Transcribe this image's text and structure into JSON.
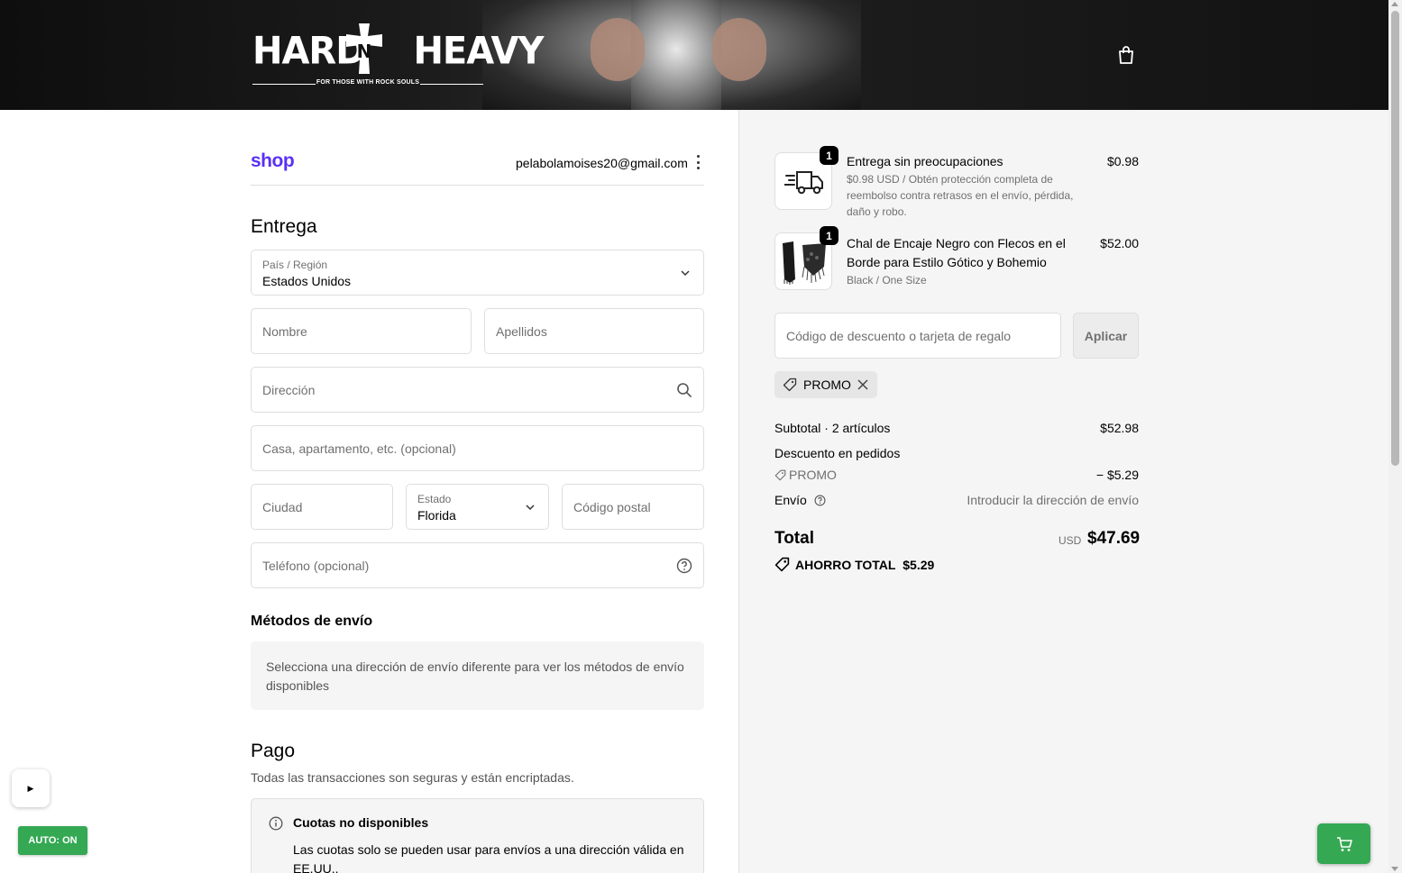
{
  "header": {
    "logo_left": "HARD",
    "logo_right": "HEAVY",
    "logo_tagline": "FOR THOSE WITH ROCK SOULS",
    "cart_icon": "shopping-bag-icon"
  },
  "account": {
    "shop_logo": "shop",
    "email": "pelabolamoises20@gmail.com",
    "menu_icon": "kebab-menu-icon"
  },
  "delivery": {
    "title": "Entrega",
    "country": {
      "label": "País / Región",
      "value": "Estados Unidos"
    },
    "first_name": {
      "placeholder": "Nombre"
    },
    "last_name": {
      "placeholder": "Apellidos"
    },
    "address": {
      "placeholder": "Dirección"
    },
    "apartment": {
      "placeholder": "Casa, apartamento, etc. (opcional)"
    },
    "city": {
      "placeholder": "Ciudad"
    },
    "state": {
      "label": "Estado",
      "value": "Florida"
    },
    "postal": {
      "placeholder": "Código postal"
    },
    "phone": {
      "placeholder": "Teléfono (opcional)"
    }
  },
  "shipping_methods": {
    "title": "Métodos de envío",
    "message": "Selecciona una dirección de envío diferente para ver los métodos de envío disponibles"
  },
  "payment": {
    "title": "Pago",
    "subtitle": "Todas las transacciones son seguras y están encriptadas.",
    "notice_title": "Cuotas no disponibles",
    "notice_text": "Las cuotas solo se pueden usar para envíos a una dirección válida en EE.UU.."
  },
  "summary": {
    "items": [
      {
        "qty": "1",
        "title": "Entrega sin preocupaciones",
        "subtitle": "$0.98 USD / Obtén protección completa de reembolso contra retrasos en el envío, pérdida, daño y robo.",
        "price": "$0.98",
        "thumb_icon": "delivery-truck-icon"
      },
      {
        "qty": "1",
        "title": "Chal de Encaje Negro con Flecos en el Borde para Estilo Gótico y Bohemio",
        "subtitle": "Black / One Size",
        "price": "$52.00",
        "thumb_icon": "black-shawl-image"
      }
    ],
    "discount_placeholder": "Código de descuento o tarjeta de regalo",
    "apply_label": "Aplicar",
    "applied_code": "PROMO",
    "subtotal_label": "Subtotal · 2 artículos",
    "subtotal_value": "$52.98",
    "order_discount_label": "Descuento en pedidos",
    "discount_code": "PROMO",
    "discount_value": "− $5.29",
    "shipping_label": "Envío",
    "shipping_value": "Introducir la dirección de envío",
    "total_label": "Total",
    "total_currency": "USD",
    "total_value": "$47.69",
    "savings_label": "AHORRO TOTAL",
    "savings_value": "$5.29"
  },
  "widgets": {
    "play_label": "▶",
    "auto_label": "AUTO: ON",
    "cart_float_icon": "shopping-cart-icon"
  },
  "colors": {
    "shop_brand": "#5a31f4",
    "widget_green": "#34a853",
    "summary_bg": "#f5f5f5"
  }
}
